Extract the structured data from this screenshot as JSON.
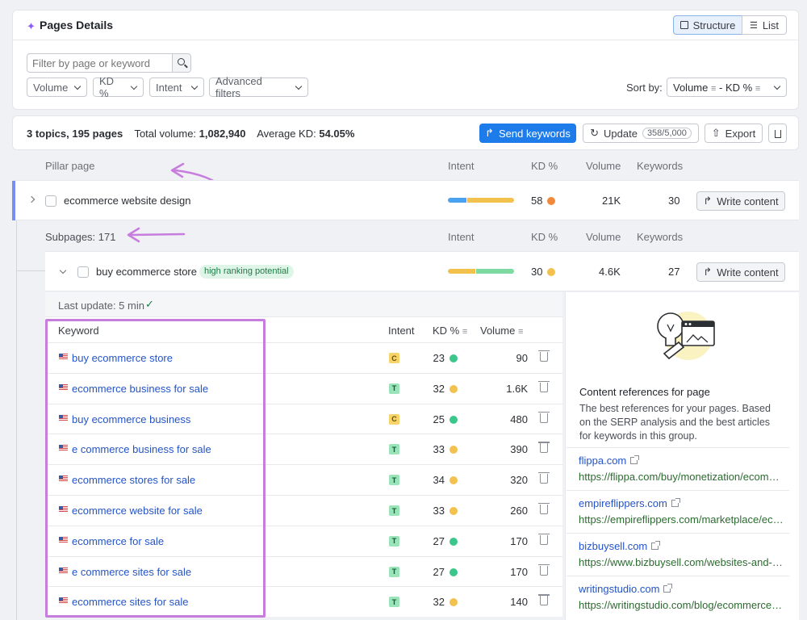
{
  "header": {
    "title": "Pages Details",
    "view_structure": "Structure",
    "view_list": "List"
  },
  "filters": {
    "search_placeholder": "Filter by page or keyword",
    "volume": "Volume",
    "kd": "KD %",
    "intent": "Intent",
    "advanced": "Advanced filters",
    "sort_label": "Sort by:",
    "sort_value": "Volume",
    "sort_secondary": "- KD %"
  },
  "summary": {
    "topics": "3 topics, 195 pages",
    "total_volume_label": "Total volume:",
    "total_volume": "1,082,940",
    "avg_kd_label": "Average KD:",
    "avg_kd": "54.05%",
    "send_keywords": "Send keywords",
    "update": "Update",
    "update_count": "358/5,000",
    "export": "Export"
  },
  "pillar_header": {
    "page": "Pillar page",
    "intent": "Intent",
    "kd": "KD %",
    "volume": "Volume",
    "keywords": "Keywords"
  },
  "pillar": {
    "name": "ecommerce website design",
    "kd": "58",
    "volume": "21K",
    "keywords": "30",
    "write": "Write content",
    "intent_split": [
      0.28,
      0.72
    ]
  },
  "sub_header": {
    "label": "Subpages: 171",
    "intent": "Intent",
    "kd": "KD %",
    "volume": "Volume",
    "keywords": "Keywords"
  },
  "subpage": {
    "name": "buy ecommerce store",
    "badge": "high ranking potential",
    "kd": "30",
    "volume": "4.6K",
    "keywords": "27",
    "write": "Write content",
    "intent_split": [
      0.42,
      0.58
    ]
  },
  "last_update": "Last update: 5 min",
  "kw_table": {
    "col_keyword": "Keyword",
    "col_intent": "Intent",
    "col_kd": "KD %",
    "col_volume": "Volume",
    "rows": [
      {
        "keyword": "buy ecommerce store",
        "intent": "C",
        "kd": "23",
        "kd_color": "#3cc78a",
        "volume": "90"
      },
      {
        "keyword": "ecommerce business for sale",
        "intent": "T",
        "kd": "32",
        "kd_color": "#f2c14e",
        "volume": "1.6K"
      },
      {
        "keyword": "buy ecommerce business",
        "intent": "C",
        "kd": "25",
        "kd_color": "#3cc78a",
        "volume": "480"
      },
      {
        "keyword": "e commerce business for sale",
        "intent": "T",
        "kd": "33",
        "kd_color": "#f2c14e",
        "volume": "390"
      },
      {
        "keyword": "ecommerce stores for sale",
        "intent": "T",
        "kd": "34",
        "kd_color": "#f2c14e",
        "volume": "320"
      },
      {
        "keyword": "ecommerce website for sale",
        "intent": "T",
        "kd": "33",
        "kd_color": "#f2c14e",
        "volume": "260"
      },
      {
        "keyword": "ecommerce for sale",
        "intent": "T",
        "kd": "27",
        "kd_color": "#3cc78a",
        "volume": "170"
      },
      {
        "keyword": "e commerce sites for sale",
        "intent": "T",
        "kd": "27",
        "kd_color": "#3cc78a",
        "volume": "170"
      },
      {
        "keyword": "ecommerce sites for sale",
        "intent": "T",
        "kd": "32",
        "kd_color": "#f2c14e",
        "volume": "140"
      }
    ]
  },
  "references": {
    "title": "Content references for page",
    "desc": "The best references for your pages. Based on the SERP analysis and the best articles for keywords in this group.",
    "items": [
      {
        "domain": "flippa.com",
        "url": "https://flippa.com/buy/monetization/ecommerce"
      },
      {
        "domain": "empireflippers.com",
        "url": "https://empireflippers.com/marketplace/ecommerce"
      },
      {
        "domain": "bizbuysell.com",
        "url": "https://www.bizbuysell.com/websites-and-ecommerce"
      },
      {
        "domain": "writingstudio.com",
        "url": "https://writingstudio.com/blog/ecommerce-stores"
      }
    ]
  },
  "colors": {
    "accent": "#1d7bea",
    "kd_orange": "#f08a3a",
    "kd_yellow": "#f2c14e",
    "kd_green": "#3cc78a",
    "intent_blue": "#4aa3f0",
    "intent_yellow": "#f2c14e",
    "intent_green": "#7ed9a3",
    "annotation": "#c77dde"
  }
}
